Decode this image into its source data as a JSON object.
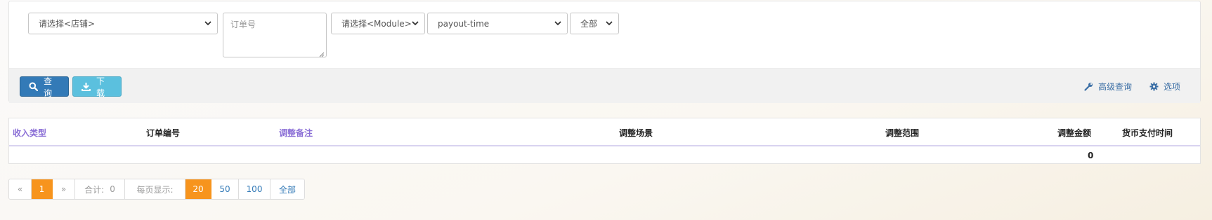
{
  "filters": {
    "store_select": "请选择<店铺>",
    "order_placeholder": "订单号",
    "module_select": "请选择<Module>",
    "time_select": "payout-time",
    "scope_select": "全部"
  },
  "actions": {
    "query_label": "查询",
    "download_label": "下载",
    "advanced_label": "高级查询",
    "options_label": "选项"
  },
  "table": {
    "headers": {
      "income_type": "收入类型",
      "order_no": "订单编号",
      "adjust_note": "调整备注",
      "adjust_scene": "调整场景",
      "adjust_range": "调整范围",
      "adjust_amount": "调整金额",
      "currency": "货币",
      "pay_time": "支付时间"
    },
    "summary": {
      "adjust_amount": "0"
    }
  },
  "pager": {
    "prev": "«",
    "current_page": "1",
    "next": "»",
    "total_label": "合计:",
    "total_value": "0",
    "per_page_label": "每页显示:",
    "sizes": [
      "20",
      "50",
      "100",
      "全部"
    ]
  },
  "colors": {
    "primary": "#337ab7",
    "info": "#5bc0de",
    "accent_orange": "#f7941d",
    "sort_link": "#8b6fd6"
  },
  "icons": {
    "query": "search-icon",
    "download": "download-icon",
    "advanced": "wrench-icon",
    "options": "gear-icon"
  }
}
